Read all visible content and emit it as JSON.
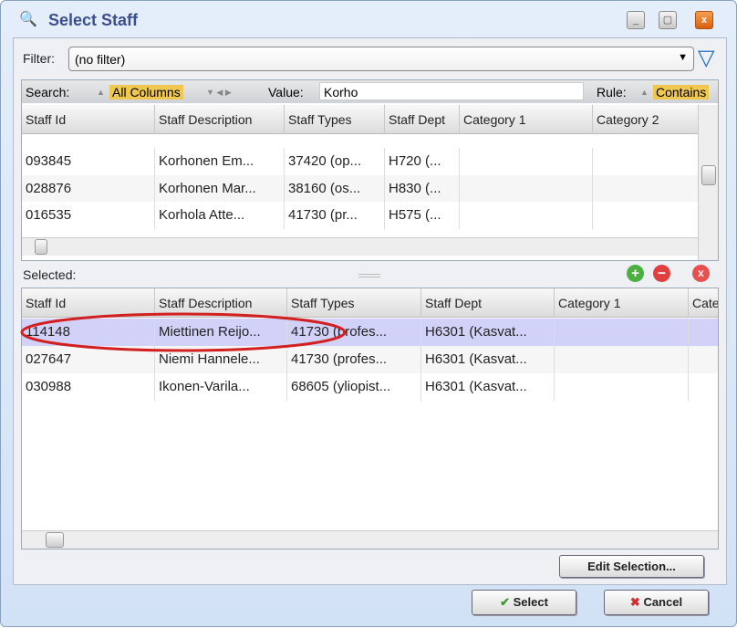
{
  "window": {
    "title": "Select Staff",
    "icon": "magnifier-icon"
  },
  "filter": {
    "label": "Filter:",
    "value": "(no filter)"
  },
  "search": {
    "label": "Search:",
    "column": "All Columns",
    "value_label": "Value:",
    "value": "Korho",
    "rule_label": "Rule:",
    "rule": "Contains"
  },
  "results": {
    "columns": [
      "Staff Id",
      "Staff Description",
      "Staff Types",
      "Staff Dept",
      "Category 1",
      "Category 2"
    ],
    "rows": [
      [
        "093845",
        "Korhonen Em...",
        "37420 (op...",
        "H720 (..."
      ],
      [
        "028876",
        "Korhonen Mar...",
        "38160 (os...",
        "H830 (..."
      ],
      [
        "016535",
        "Korhola Atte...",
        "41730 (pr...",
        "H575 (..."
      ]
    ]
  },
  "selected": {
    "label": "Selected:",
    "columns": [
      "Staff Id",
      "Staff Description",
      "Staff Types",
      "Staff Dept",
      "Category 1",
      "Cate"
    ],
    "rows": [
      [
        "114148",
        "Miettinen Reijo...",
        "41730 (profes...",
        "H6301 (Kasvat..."
      ],
      [
        "027647",
        "Niemi Hannele...",
        "41730 (profes...",
        "H6301 (Kasvat..."
      ],
      [
        "030988",
        "Ikonen-Varila...",
        "68605 (yliopist...",
        "H6301 (Kasvat..."
      ]
    ],
    "highlight_color": "#d22020"
  },
  "buttons": {
    "edit": "Edit Selection...",
    "select": "Select",
    "cancel": "Cancel"
  }
}
